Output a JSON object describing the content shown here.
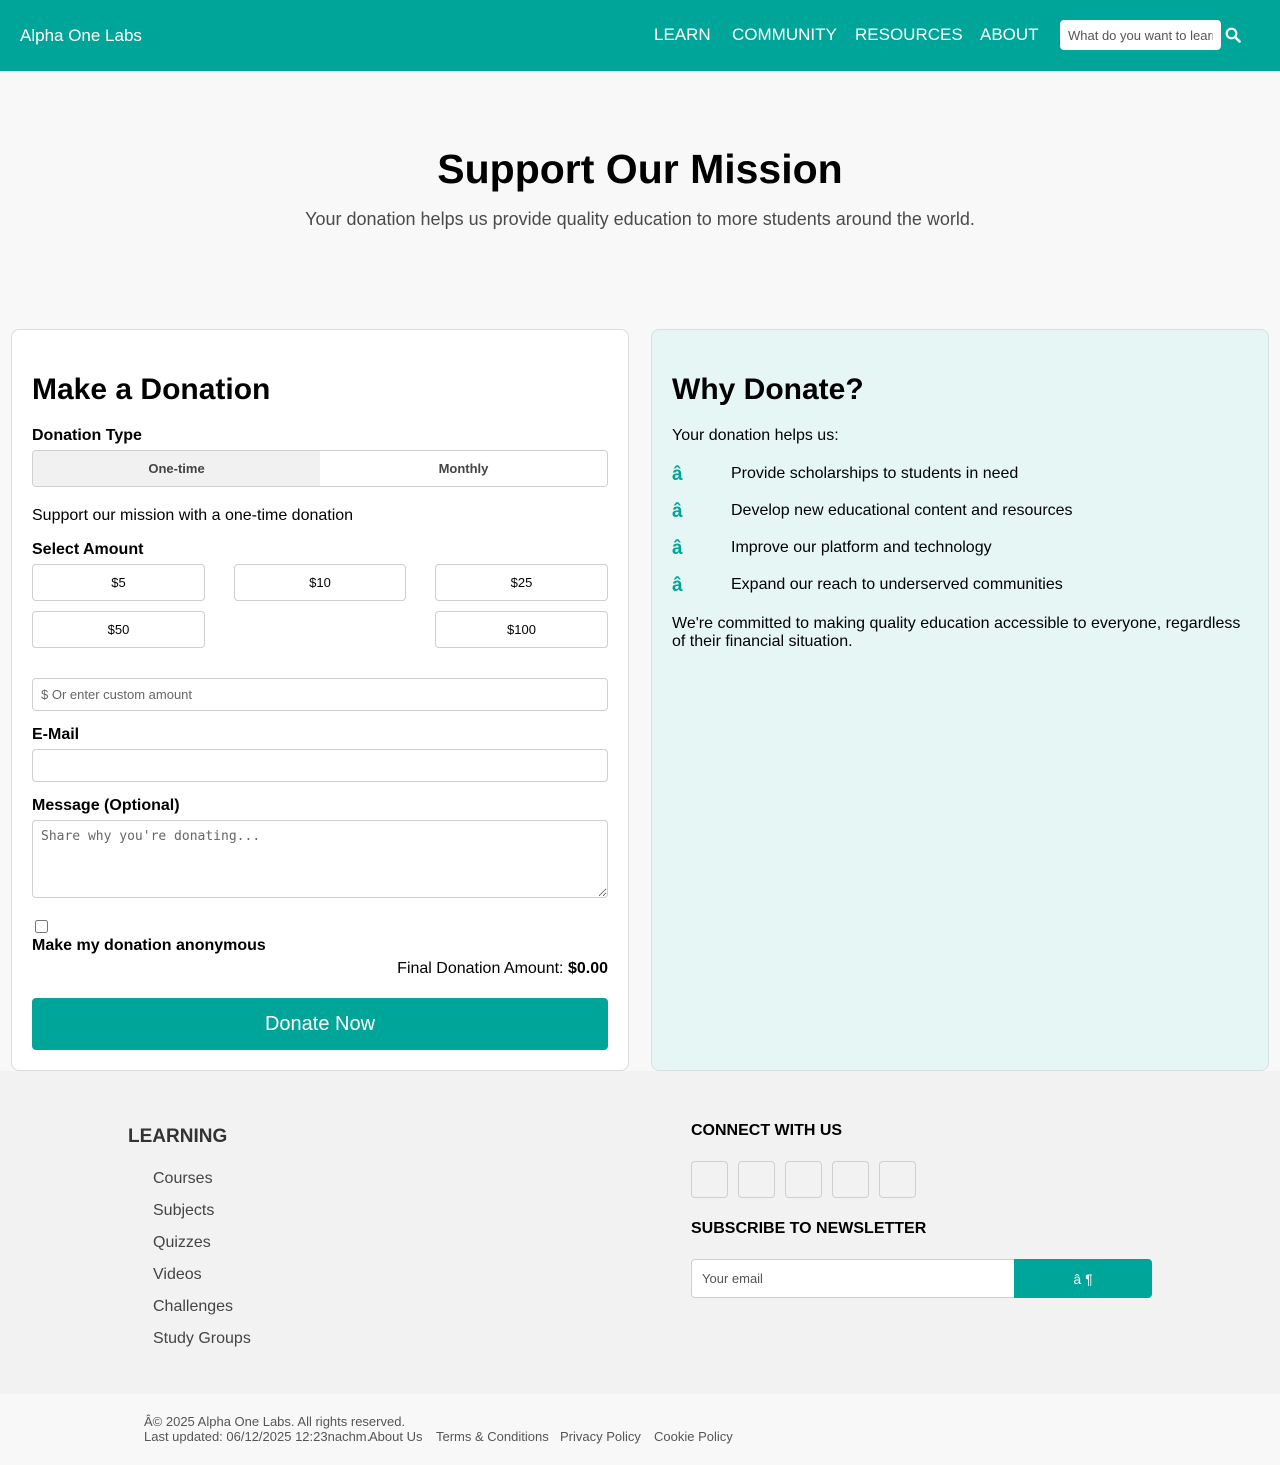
{
  "header": {
    "brand": "Alpha One Labs",
    "nav": [
      "LEARN",
      "COMMUNITY",
      "RESOURCES",
      "ABOUT"
    ],
    "search_placeholder": "What do you want to learn?",
    "search_icon": "search-icon",
    "background": "#00a59a"
  },
  "hero": {
    "title": "Support Our Mission",
    "subtitle": "Your donation helps us provide quality education to more students around the world."
  },
  "donation_form": {
    "title": "Make a Donation",
    "type_label": "Donation Type",
    "types": [
      "One-time",
      "Monthly"
    ],
    "selected_type": "One-time",
    "type_description": "Support our mission with a one-time donation",
    "amount_label": "Select Amount",
    "amounts": [
      "$5",
      "$10",
      "$25",
      "$50",
      "$100"
    ],
    "custom_placeholder": "$ Or enter custom amount",
    "email_label": "E-Mail",
    "email_value": "",
    "message_label": "Message (Optional)",
    "message_placeholder": "Share why you're donating...",
    "anonymous_label": "Make my donation anonymous",
    "anonymous_checked": false,
    "final_label": "Final Donation Amount:",
    "final_amount": "$0.00",
    "submit_label": "Donate Now"
  },
  "why_donate": {
    "title": "Why Donate?",
    "intro": "Your donation helps us:",
    "marker": "â",
    "items": [
      "Provide scholarships to students in need",
      "Develop new educational content and resources",
      "Improve our platform and technology",
      "Expand our reach to underserved communities"
    ],
    "closing": "We're committed to making quality education accessible to everyone, regardless of their financial situation."
  },
  "footer": {
    "learning_title": "LEARNING",
    "learning_links": [
      "Courses",
      "Subjects",
      "Quizzes",
      "Videos",
      "Challenges",
      "Study Groups"
    ],
    "connect_title": "CONNECT WITH US",
    "newsletter_title": "SUBSCRIBE TO NEWSLETTER",
    "newsletter_placeholder": "Your email",
    "newsletter_button": "â ¶",
    "copyright": "Â© 2025 Alpha One Labs. All rights reserved.",
    "last_updated": "Last updated: 06/12/2025 12:23nachm.",
    "bottom_links": [
      "About Us",
      "Terms & Conditions",
      "Privacy Policy",
      "Cookie Policy"
    ]
  }
}
